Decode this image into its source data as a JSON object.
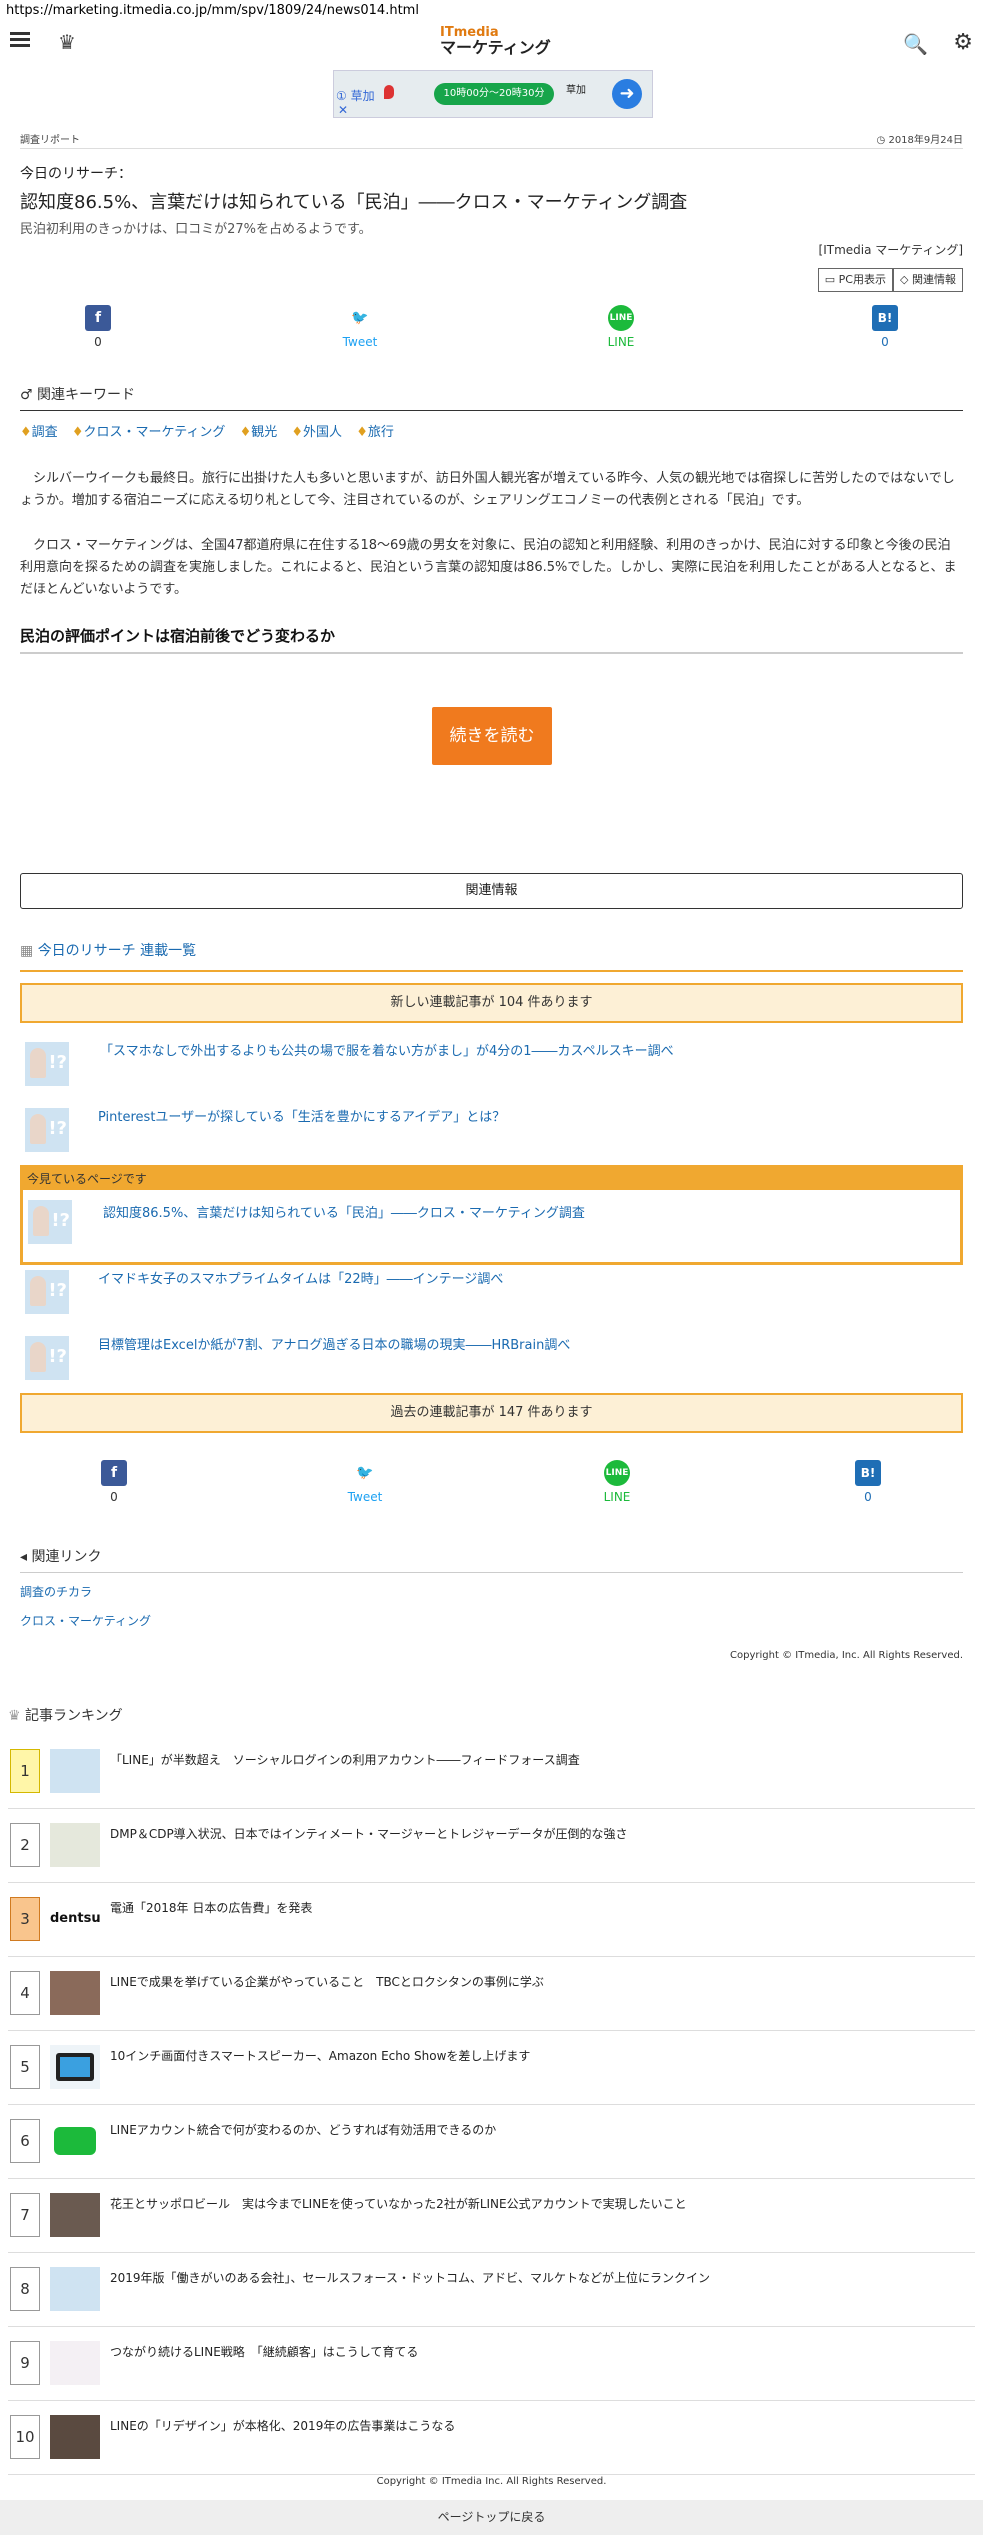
{
  "url": "https://marketing.itmedia.co.jp/mm/spv/1809/24/news014.html",
  "header": {
    "logo_top": "ITmedia",
    "logo_bottom": "マーケティング"
  },
  "ad": {
    "t1": "① 草加",
    "t2": "✕",
    "button": "10時00分～20時30分",
    "t3": "草加"
  },
  "meta": {
    "category": "調査リポート",
    "date": "2018年9月24日"
  },
  "article": {
    "kicker": "今日のリサーチ：",
    "title": "認知度86.5%、言葉だけは知られている「民泊」――クロス・マーケティング調査",
    "subtitle": "民泊初利用のきっかけは、口コミが27%を占めるようです。",
    "byline": "[ITmedia マーケティング]",
    "pc_button": "PC用表示",
    "related_button": "関連情報",
    "p1": "シルバーウイークも最終日。旅行に出掛けた人も多いと思いますが、訪日外国人観光客が増えている昨今、人気の観光地では宿探しに苦労したのではないでしょうか。増加する宿泊ニーズに応える切り札として今、注目されているのが、シェアリングエコノミーの代表例とされる「民泊」です。",
    "p2": "クロス・マーケティングは、全国47都道府県に在住する18～69歳の男女を対象に、民泊の認知と利用経験、利用のきっかけ、民泊に対する印象と今後の民泊利用意向を探るための調査を実施しました。これによると、民泊という言葉の認知度は86.5%でした。しかし、実際に民泊を利用したことがある人となると、まだほとんどいないようです。",
    "h2": "民泊の評価ポイントは宿泊前後でどう変わるか",
    "read_more": "続きを読む"
  },
  "share": {
    "fb_count": "0",
    "tweet": "Tweet",
    "line": "LINE",
    "hb_count": "0",
    "fb_icon": "f",
    "tw_icon": "🐦",
    "line_icon": "LINE",
    "hb_icon": "B!"
  },
  "keywords": {
    "heading": "関連キーワード",
    "items": [
      "調査",
      "クロス・マーケティング",
      "観光",
      "外国人",
      "旅行"
    ]
  },
  "related_info": "関連情報",
  "series": {
    "heading": "今日のリサーチ 連載一覧",
    "newer": "新しい連載記事が 104 件あります",
    "older": "過去の連載記事が 147 件あります",
    "current_label": "今見ているページです",
    "items": [
      "「スマホなしで外出するよりも公共の場で服を着ない方がまし」が4分の1――カスペルスキー調べ",
      "Pinterestユーザーが探している「生活を豊かにするアイデア」とは？",
      "認知度86.5%、言葉だけは知られている「民泊」――クロス・マーケティング調査",
      "イマドキ女子のスマホプライムタイムは「22時」――インテージ調べ",
      "目標管理はExcelか紙が7割、アナログ過ぎる日本の職場の現実――HRBrain調べ"
    ]
  },
  "related_links": {
    "heading": "関連リンク",
    "items": [
      "調査のチカラ",
      "クロス・マーケティング"
    ]
  },
  "copyright1": "Copyright © ITmedia, Inc. All Rights Reserved.",
  "ranking": {
    "heading": "記事ランキング",
    "items": [
      {
        "n": "1",
        "title": "「LINE」が半数超え　ソーシャルログインの利用アカウント――フィードフォース調査"
      },
      {
        "n": "2",
        "title": "DMP＆CDP導入状況、日本ではインティメート・マージャーとトレジャーデータが圧倒的な強さ"
      },
      {
        "n": "3",
        "title": "電通「2018年 日本の広告費」を発表",
        "thumb": "dentsu"
      },
      {
        "n": "4",
        "title": "LINEで成果を挙げている企業がやっていること　TBCとロクシタンの事例に学ぶ"
      },
      {
        "n": "5",
        "title": "10インチ画面付きスマートスピーカー、Amazon Echo Showを差し上げます"
      },
      {
        "n": "6",
        "title": "LINEアカウント統合で何が変わるのか、どうすれば有効活用できるのか"
      },
      {
        "n": "7",
        "title": "花王とサッポロビール　実は今までLINEを使っていなかった2社が新LINE公式アカウントで実現したいこと"
      },
      {
        "n": "8",
        "title": "2019年版「働きがいのある会社」、セールスフォース・ドットコム、アドビ、マルケトなどが上位にランクイン"
      },
      {
        "n": "9",
        "title": "つながり続けるLINE戦略　「継続顧客」はこうして育てる"
      },
      {
        "n": "10",
        "title": "LINEの「リデザイン」が本格化、2019年の広告事業はこうなる"
      }
    ]
  },
  "copyright2": "Copyright © ITmedia Inc. All Rights Reserved.",
  "back_to_top": "ページトップに戻る"
}
